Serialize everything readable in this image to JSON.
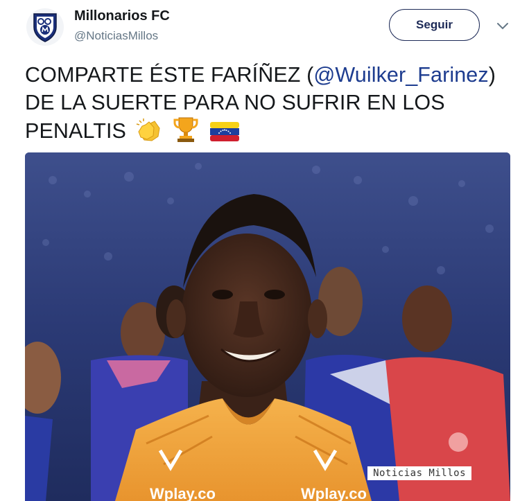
{
  "account": {
    "name": "Millonarios FC",
    "handle": "@NoticiasMillos",
    "avatar_icon": "millonarios-crest-icon"
  },
  "actions": {
    "follow_label": "Seguir",
    "menu_icon": "chevron-down-icon"
  },
  "tweet": {
    "text_before": "COMPARTE ÉSTE FARÍÑEZ (",
    "mention": "@Wuilker_Farinez",
    "text_after": ") DE LA SUERTE PARA NO SUFRIR EN LOS PENALTIS",
    "emojis": [
      "clapping-hands-emoji",
      "trophy-emoji",
      "venezuela-flag-emoji"
    ]
  },
  "media": {
    "watermark": "Noticias Millos",
    "sponsor_text": [
      "Wplay.co",
      "Wplay.co"
    ]
  },
  "colors": {
    "accent": "#1d2a57",
    "mention": "#1d3c8f",
    "jersey": "#f2a640"
  }
}
